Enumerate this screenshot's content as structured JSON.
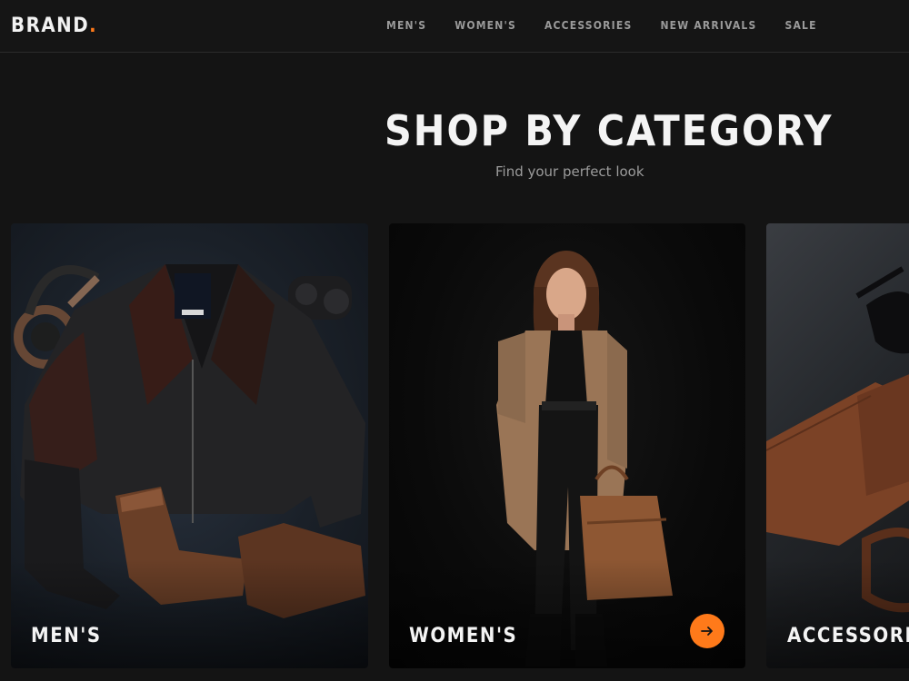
{
  "header": {
    "brand": "BRAND",
    "brand_dot": ".",
    "nav": [
      "MEN'S",
      "WOMEN'S",
      "ACCESSORIES",
      "NEW ARRIVALS",
      "SALE"
    ]
  },
  "hero": {
    "title": "SHOP BY CATEGORY",
    "subtitle": "Find your perfect look"
  },
  "categories": [
    {
      "label": "MEN'S",
      "image": "leather-jacket-flatlay"
    },
    {
      "label": "WOMEN'S",
      "image": "woman-tan-blazer-portrait",
      "action_icon": "arrow-right-icon"
    },
    {
      "label": "ACCESSORIES",
      "image": "brown-leather-wallet-sunglasses"
    }
  ],
  "colors": {
    "accent": "#ff7a1a",
    "background": "#141414",
    "nav_text": "#9a9a9a"
  }
}
